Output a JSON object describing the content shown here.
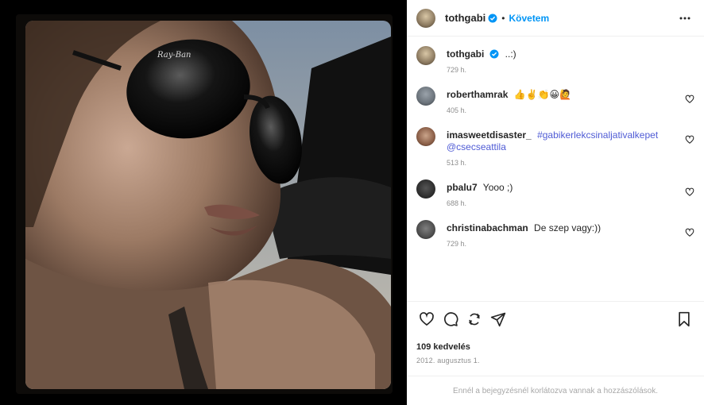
{
  "post": {
    "author": "tothgabi",
    "follow_label": "Követem",
    "dot": "•",
    "caption": "..:)",
    "caption_time": "729 h."
  },
  "comments": [
    {
      "user": "roberthamrak",
      "text": "👍✌️👏😀🙋",
      "time": "405 h."
    },
    {
      "user": "imasweetdisaster_",
      "text": "#gabikerlekcsinaljativalkepet @csecseattila",
      "time": "513 h."
    },
    {
      "user": "pbalu7",
      "text": "Yooo ;)",
      "time": "688 h."
    },
    {
      "user": "christinabachman",
      "text": "De szep vagy:))",
      "time": "729 h."
    }
  ],
  "stats": {
    "likes": "109 kedvelés",
    "date": "2012. augusztus 1."
  },
  "footer": {
    "notice": "Ennél a bejegyzésnél korlátozva vannak a hozzászólások."
  },
  "icons": {
    "more": "more-options-icon",
    "like": "heart-icon",
    "comment": "comment-icon",
    "repost": "repost-icon",
    "share": "share-icon",
    "save": "bookmark-icon",
    "verified": "verified-badge-icon"
  },
  "colors": {
    "accent": "#0095f6",
    "hashtag": "#4f5bd5",
    "muted": "#8e8e8e"
  }
}
